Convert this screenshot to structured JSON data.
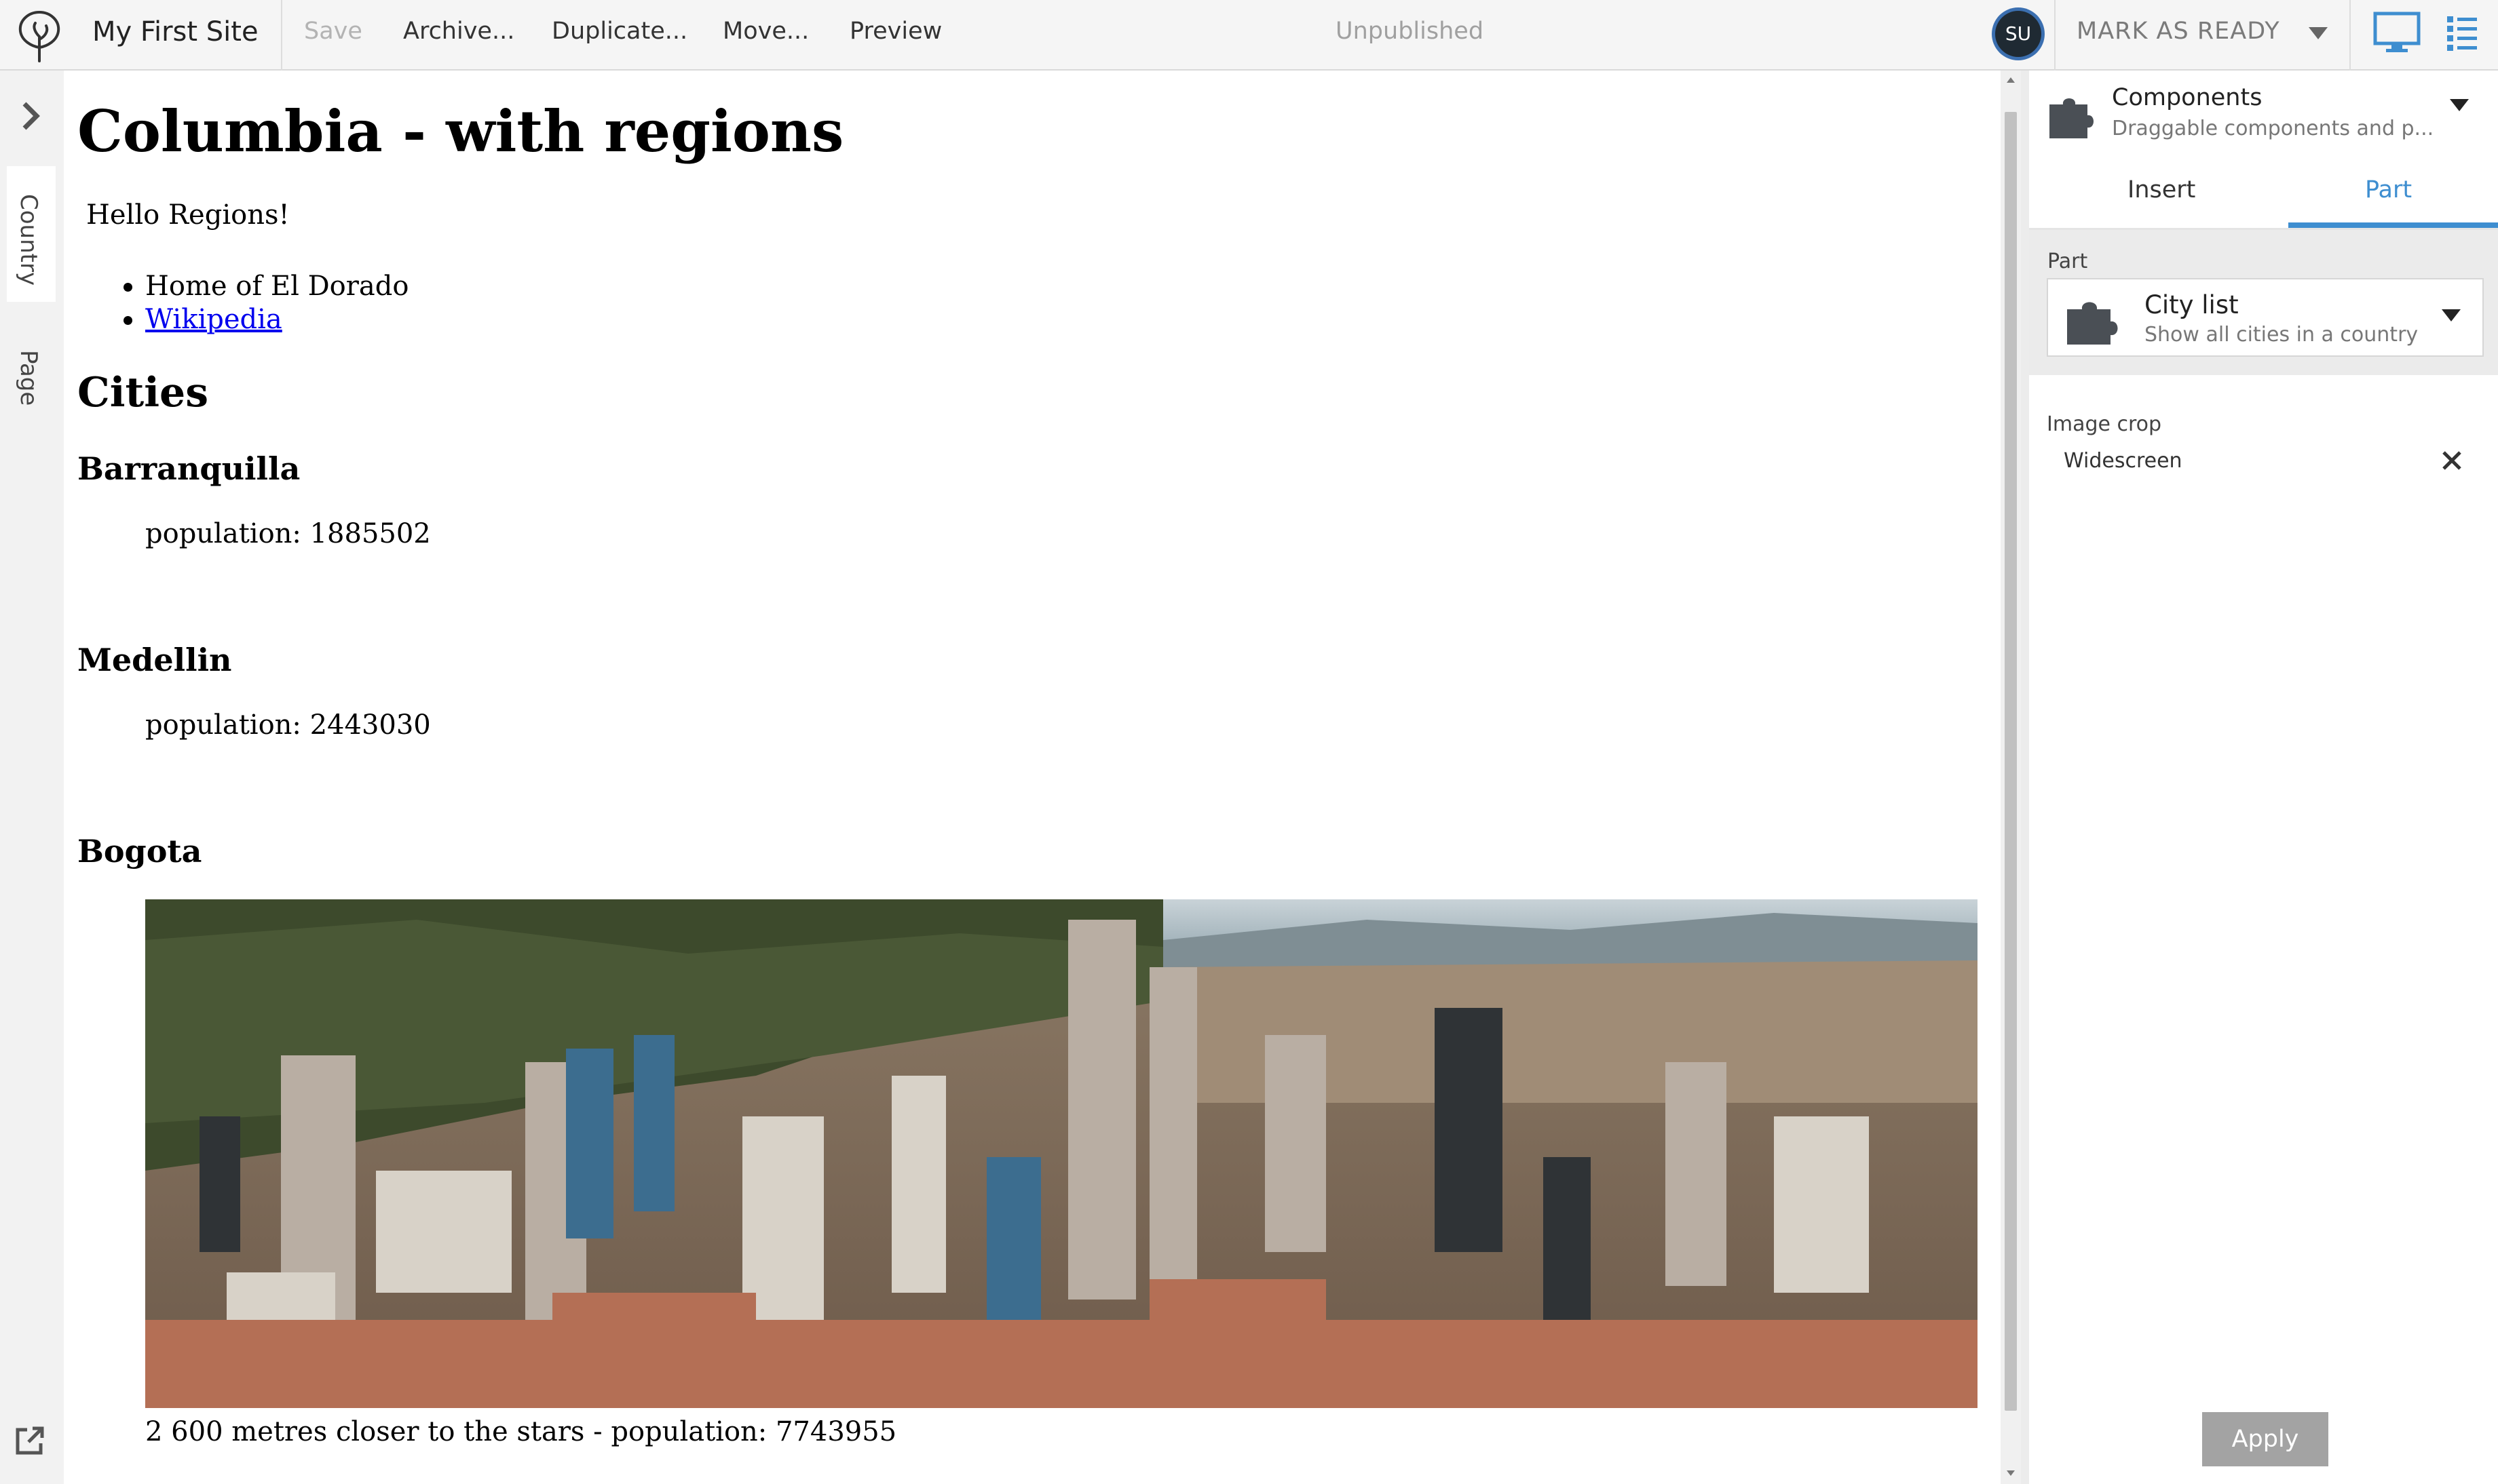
{
  "toolbar": {
    "site_name": "My First Site",
    "save_label": "Save",
    "archive_label": "Archive...",
    "duplicate_label": "Duplicate...",
    "move_label": "Move...",
    "preview_label": "Preview",
    "status": "Unpublished",
    "avatar_initials": "SU",
    "mark_ready_label": "MARK AS READY",
    "accent_color": "#3e8ed0"
  },
  "left_rail": {
    "tab_country": "Country",
    "tab_page": "Page"
  },
  "page": {
    "title": "Columbia - with regions",
    "intro": "Hello Regions!",
    "links": [
      "Home of El Dorado",
      "Wikipedia"
    ],
    "cities_heading": "Cities",
    "cities": [
      {
        "name": "Barranquilla",
        "population_text": "population: 1885502"
      },
      {
        "name": "Medellin",
        "population_text": "population: 2443030"
      },
      {
        "name": "Bogota",
        "caption": "2 600 metres closer to the stars - population: 7743955"
      }
    ]
  },
  "panel": {
    "components_title": "Components",
    "components_subtitle": "Draggable components and p...",
    "tabs": [
      {
        "label": "Insert",
        "active": false
      },
      {
        "label": "Part",
        "active": true
      }
    ],
    "part_label": "Part",
    "part_selected_title": "City list",
    "part_selected_desc": "Show all cities in a country",
    "image_crop_label": "Image crop",
    "image_crop_value": "Widescreen",
    "apply_label": "Apply"
  }
}
